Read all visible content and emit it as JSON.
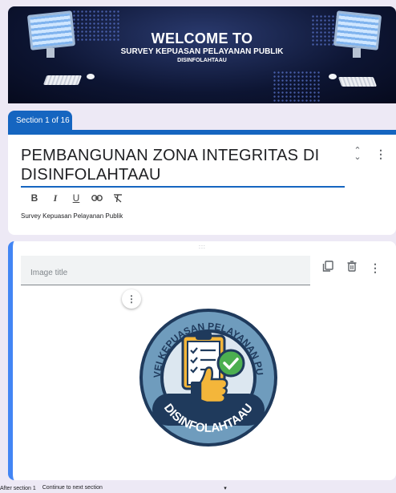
{
  "banner": {
    "welcome": "WELCOME TO",
    "survey": "SURVEY KEPUASAN PELAYANAN  PUBLIK",
    "org": "DISINFOLAHTAAU"
  },
  "section_tab": {
    "label": "Section 1 of 16"
  },
  "title_card": {
    "title": "PEMBANGUNAN ZONA INTEGRITAS DI DISINFOLAHTAAU",
    "description": "Survey Kepuasan Pelayanan Publik",
    "format_buttons": [
      "B",
      "I",
      "U",
      "link",
      "clear-format"
    ]
  },
  "image_card": {
    "title_placeholder": "Image title",
    "drag_handle": ":::",
    "logo_top_text": "SURVEI KEPUASAN PELAYANAN PUBLIK",
    "logo_bottom_text": "DISINFOLAHTAAU"
  },
  "after_section": {
    "label": "After section 1",
    "value": "Continue to next section"
  },
  "colors": {
    "accent": "#1565c0",
    "card_left_border": "#4285f4",
    "logo_navy": "#1f3a5c",
    "logo_teal": "#5a8fb0",
    "check_green": "#4caf50",
    "thumb_yellow": "#f4b63a"
  }
}
